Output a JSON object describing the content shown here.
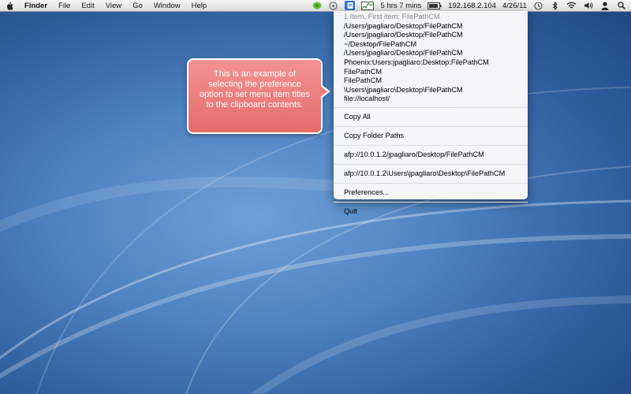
{
  "menubar": {
    "app_name": "Finder",
    "menus": [
      "File",
      "Edit",
      "View",
      "Go",
      "Window",
      "Help"
    ],
    "battery_text": "5 hrs 7 mins",
    "ip_text": "192.168.2.104",
    "date_text": "4/26/11"
  },
  "dropdown": {
    "header": "1 Item, First item: FilePathCM",
    "paths": [
      "/Users/jpagliaro/Desktop/FilePathCM",
      "/Users/jpagliaro/Desktop/FilePathCM",
      "~/Desktop/FilePathCM",
      "/Users/jpagliaro/Desktop/FilePathCM",
      "Phoenix:Users:jpagliaro:Desktop:FilePathCM",
      "FilePathCM",
      "FilePathCM",
      "\\Users\\jpagliaro\\Desktop\\FilePathCM",
      "file://localhost/"
    ],
    "copy_all": "Copy All",
    "copy_folder_paths": "Copy Folder Paths",
    "afp_forward": "afp://10.0.1.2/jpagliaro/Desktop/FilePathCM",
    "afp_backslash": "afp://10.0.1.2\\Users\\jpagliaro\\Desktop\\FilePathCM",
    "preferences": "Preferences...",
    "quit": "Quit"
  },
  "callout": {
    "text": "This is an example of selecting the preference option to set menu item titles to the clipboard contents."
  },
  "icons": {
    "apple": "apple-icon",
    "green_app": "green-app-icon",
    "gray_app": "gray-app-icon",
    "active_app": "filepath-menu-icon",
    "activity": "activity-graph-icon",
    "battery": "battery-icon",
    "time_machine": "time-machine-icon",
    "bluetooth": "bluetooth-icon",
    "wifi": "wifi-icon",
    "volume": "volume-icon",
    "user": "user-icon",
    "spotlight": "spotlight-search-icon"
  },
  "colors": {
    "menu_highlight": "#2d6fe3",
    "callout_fill": "#ec7d7d",
    "desktop_blue": "#4f83c2"
  }
}
